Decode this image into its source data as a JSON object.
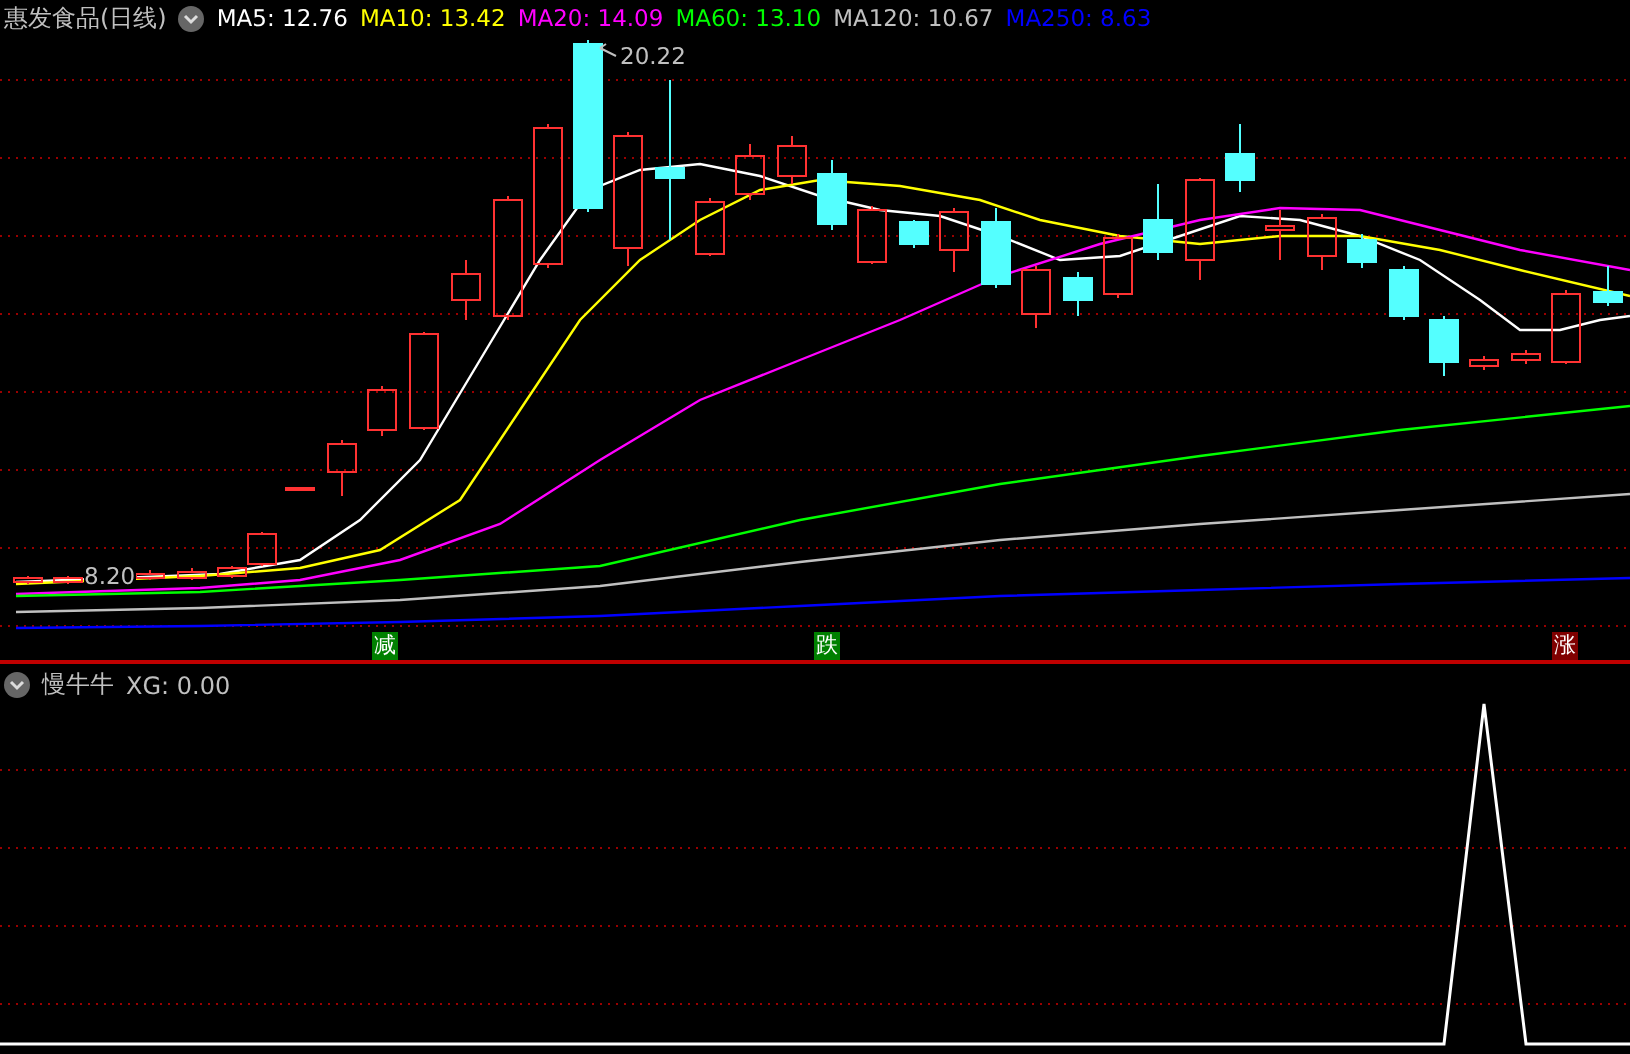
{
  "header": {
    "title": "惠发食品(日线)",
    "averages": [
      {
        "label": "MA5: 12.76",
        "color": "#ffffff"
      },
      {
        "label": "MA10: 13.42",
        "color": "#ffff00"
      },
      {
        "label": "MA20: 14.09",
        "color": "#ff00ff"
      },
      {
        "label": "MA60: 13.10",
        "color": "#00ff00"
      },
      {
        "label": "MA120: 10.67",
        "color": "#c0c0c0"
      },
      {
        "label": "MA250: 8.63",
        "color": "#0000ff"
      }
    ]
  },
  "price_chart": {
    "high_label": "20.22",
    "low_label": "8.20",
    "signals": [
      {
        "text": "减",
        "color": "#008000"
      },
      {
        "text": "跌",
        "color": "#008000"
      },
      {
        "text": "涨",
        "color": "#800000"
      }
    ]
  },
  "indicator": {
    "title": "慢牛牛",
    "reading": "XG: 0.00"
  }
}
